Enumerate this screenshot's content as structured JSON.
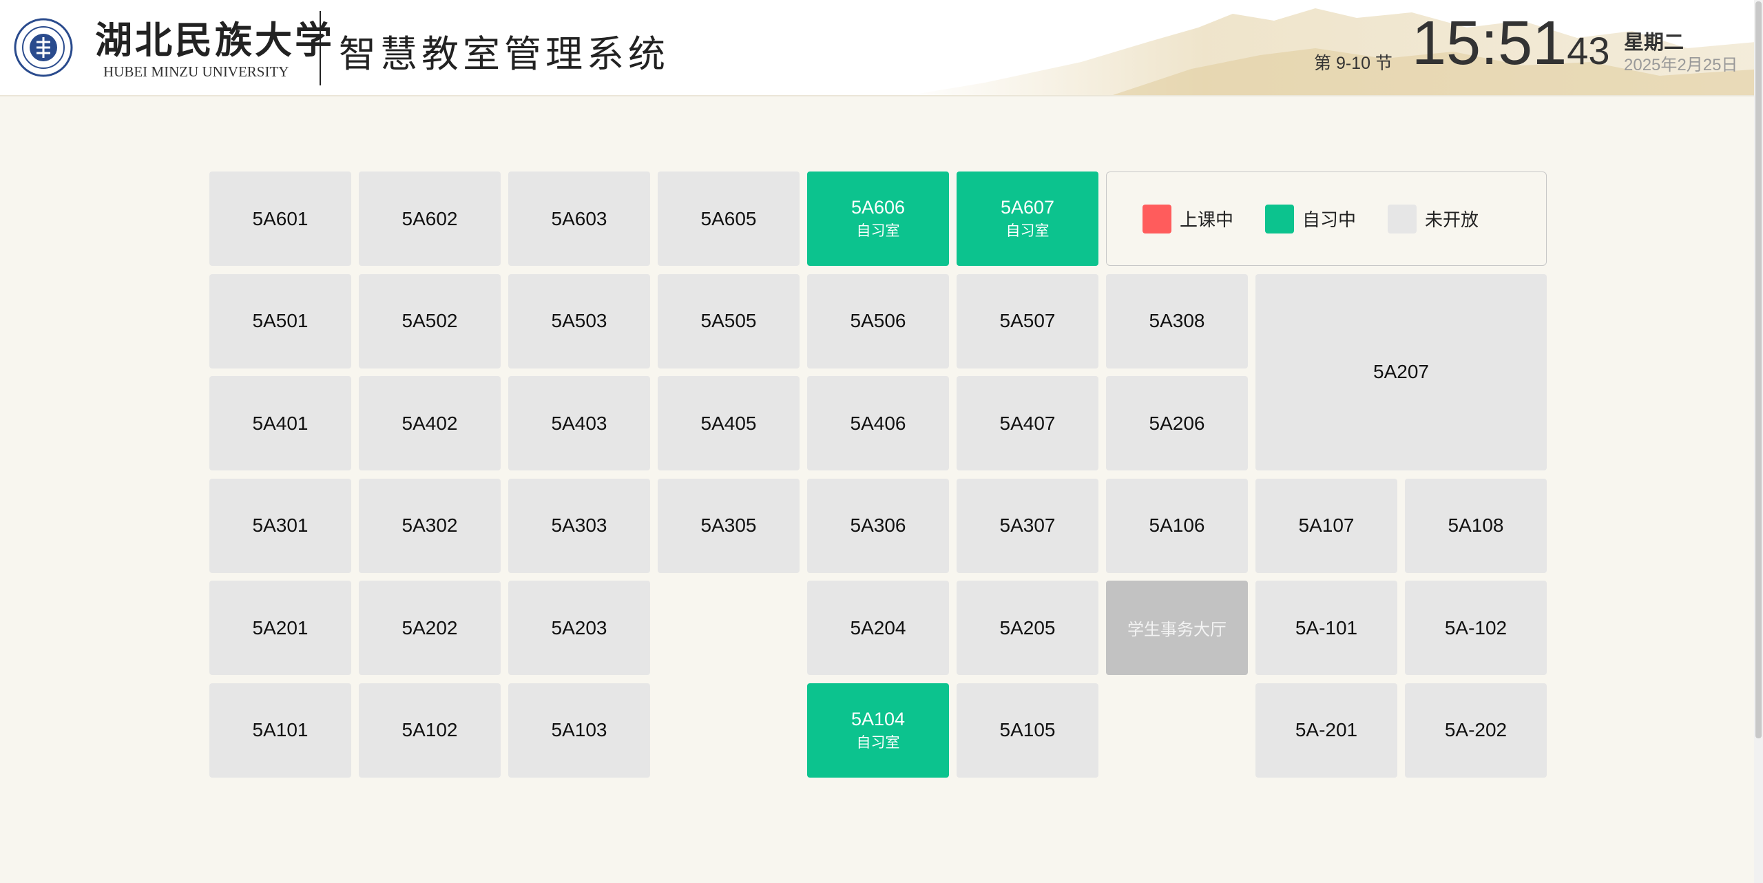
{
  "header": {
    "university_cn": "湖北民族大学",
    "university_en": "HUBEI MINZU UNIVERSITY",
    "system_title": "智慧教室管理系统",
    "period": "第 9-10 节",
    "time_hm": "15:51",
    "time_sec": "43",
    "weekday": "星期二",
    "date": "2025年2月25日"
  },
  "legend": [
    {
      "label": "上课中",
      "color": "#ff5c5c"
    },
    {
      "label": "自习中",
      "color": "#0cc38e"
    },
    {
      "label": "未开放",
      "color": "#e6e6e6"
    }
  ],
  "status_colors": {
    "closed": "#e6e6e6",
    "studying": "#0cc38e",
    "hall": "#c2c2c2"
  },
  "rooms": [
    {
      "name": "5A601",
      "status": "closed"
    },
    {
      "name": "5A602",
      "status": "closed"
    },
    {
      "name": "5A603",
      "status": "closed"
    },
    {
      "name": "5A605",
      "status": "closed"
    },
    {
      "name": "5A606",
      "status": "studying",
      "sub": "自习室"
    },
    {
      "name": "5A607",
      "status": "studying",
      "sub": "自习室"
    },
    {
      "name": "5A501",
      "status": "closed"
    },
    {
      "name": "5A502",
      "status": "closed"
    },
    {
      "name": "5A503",
      "status": "closed"
    },
    {
      "name": "5A505",
      "status": "closed"
    },
    {
      "name": "5A506",
      "status": "closed"
    },
    {
      "name": "5A507",
      "status": "closed"
    },
    {
      "name": "5A308",
      "status": "closed"
    },
    {
      "name": "5A207",
      "status": "closed"
    },
    {
      "name": "5A401",
      "status": "closed"
    },
    {
      "name": "5A402",
      "status": "closed"
    },
    {
      "name": "5A403",
      "status": "closed"
    },
    {
      "name": "5A405",
      "status": "closed"
    },
    {
      "name": "5A406",
      "status": "closed"
    },
    {
      "name": "5A407",
      "status": "closed"
    },
    {
      "name": "5A206",
      "status": "closed"
    },
    {
      "name": "5A301",
      "status": "closed"
    },
    {
      "name": "5A302",
      "status": "closed"
    },
    {
      "name": "5A303",
      "status": "closed"
    },
    {
      "name": "5A305",
      "status": "closed"
    },
    {
      "name": "5A306",
      "status": "closed"
    },
    {
      "name": "5A307",
      "status": "closed"
    },
    {
      "name": "5A106",
      "status": "closed"
    },
    {
      "name": "5A107",
      "status": "closed"
    },
    {
      "name": "5A108",
      "status": "closed"
    },
    {
      "name": "5A201",
      "status": "closed"
    },
    {
      "name": "5A202",
      "status": "closed"
    },
    {
      "name": "5A203",
      "status": "closed"
    },
    {
      "name": "5A204",
      "status": "closed"
    },
    {
      "name": "5A205",
      "status": "closed"
    },
    {
      "name": "学生事务大厅",
      "status": "hall"
    },
    {
      "name": "5A-101",
      "status": "closed"
    },
    {
      "name": "5A-102",
      "status": "closed"
    },
    {
      "name": "5A101",
      "status": "closed"
    },
    {
      "name": "5A102",
      "status": "closed"
    },
    {
      "name": "5A103",
      "status": "closed"
    },
    {
      "name": "5A104",
      "status": "studying",
      "sub": "自习室"
    },
    {
      "name": "5A105",
      "status": "closed"
    },
    {
      "name": "5A-201",
      "status": "closed"
    },
    {
      "name": "5A-202",
      "status": "closed"
    }
  ]
}
